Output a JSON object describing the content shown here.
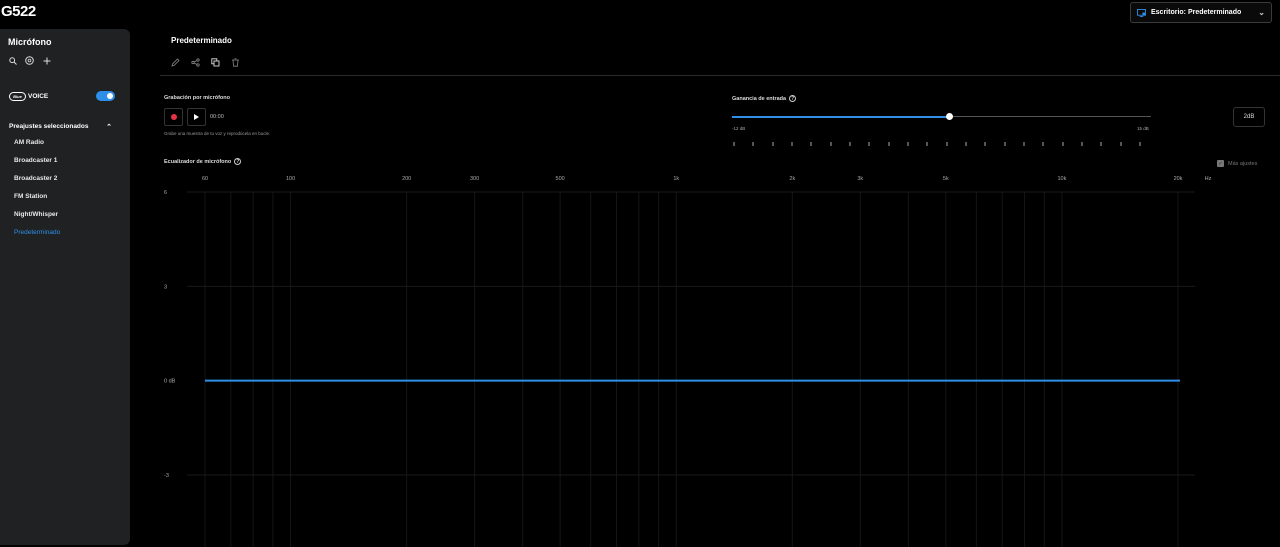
{
  "app": {
    "device": "G522"
  },
  "header": {
    "profile_label": "Escritorio: Predeterminado",
    "profile_icon": "monitor-icon"
  },
  "sidebar": {
    "title": "Micrófono",
    "tools": [
      "search-icon",
      "community-icon",
      "add-icon"
    ],
    "blue_logo": "Blue",
    "voice_label": "VOICE",
    "voice_enabled": true,
    "presets_header": "Preajustes seleccionados",
    "presets": [
      {
        "label": "AM Radio",
        "active": false
      },
      {
        "label": "Broadcaster 1",
        "active": false
      },
      {
        "label": "Broadcaster 2",
        "active": false
      },
      {
        "label": "FM Station",
        "active": false
      },
      {
        "label": "Night/Whisper",
        "active": false
      },
      {
        "label": "Predeterminado",
        "active": true
      }
    ]
  },
  "main": {
    "title": "Predeterminado",
    "tools": [
      "edit-icon",
      "share-icon",
      "duplicate-icon",
      "delete-icon"
    ]
  },
  "recording": {
    "label": "Grabación por micrófono",
    "time": "00:00",
    "hint": "Grabe una muestra de tu voz y reprodúcela en bucle."
  },
  "gain": {
    "label": "Ganancia de entrada",
    "min_label": "-12 dB",
    "max_label": "15 dB",
    "min": -12,
    "max": 15,
    "value": 2,
    "value_label": "2dB",
    "tick_count": 22
  },
  "eq": {
    "label": "Ecualizador de micrófono",
    "more_adjustments": "Más ajustes",
    "more_adjustments_checked": true,
    "freq_labels": [
      "60",
      "100",
      "200",
      "300",
      "500",
      "1k",
      "2k",
      "3k",
      "5k",
      "10k",
      "20k"
    ],
    "freq_unit": "Hz",
    "db_labels": [
      {
        "label": "6",
        "value": 6
      },
      {
        "label": "3",
        "value": 3
      },
      {
        "label": "0 dB",
        "value": 0
      },
      {
        "label": "-3",
        "value": -3
      }
    ],
    "curve_gain_db": 0
  },
  "colors": {
    "accent": "#2f8fe8",
    "record": "#e63244",
    "sidebar_bg": "#1f2123"
  }
}
